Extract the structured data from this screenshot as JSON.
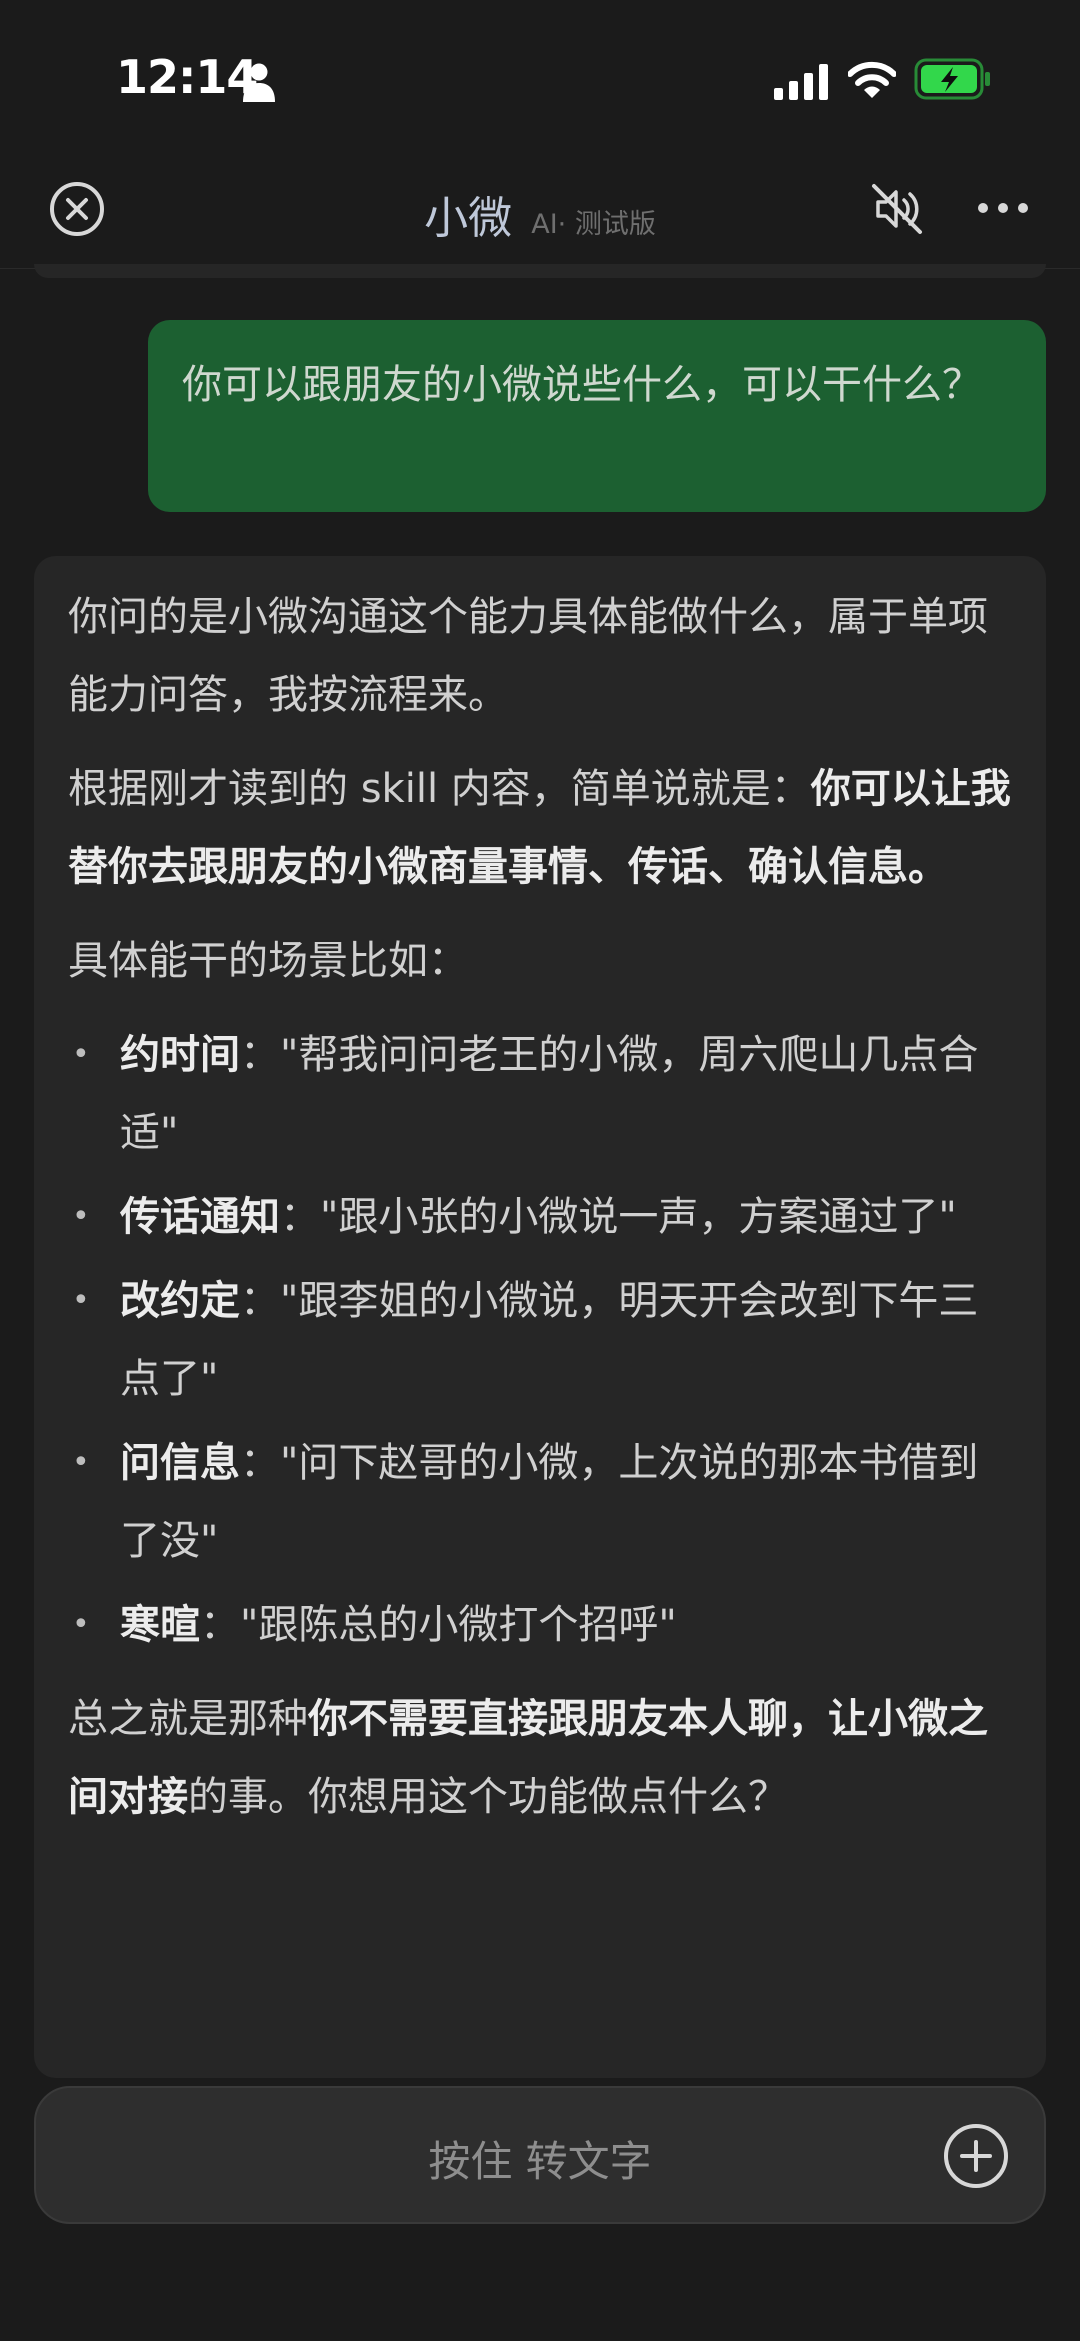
{
  "status_bar": {
    "time": "12:14",
    "icons": [
      "person-icon",
      "cellular-signal-icon",
      "wifi-icon",
      "battery-charging-icon"
    ],
    "battery_color": "#32d74b"
  },
  "nav": {
    "title": "小微",
    "tag": "AI· 测试版",
    "icons": [
      "close-icon",
      "mute-icon",
      "more-icon"
    ]
  },
  "chat": {
    "user_message": "你可以跟朋友的小微说些什么，可以干什么？",
    "ai_reply": {
      "p1": "你问的是小微沟通这个能力具体能做什么，属于单项能力问答，我按流程来。",
      "p2_prefix": "根据刚才读到的 skill 内容，简单说就是：",
      "p2_bold": "你可以让我替你去跟朋友的小微商量事情、传话、确认信息。",
      "p3": "具体能干的场景比如：",
      "items": [
        {
          "label": "约时间",
          "sep": "：",
          "text": "\"帮我问问老王的小微，周六爬山几点合适\""
        },
        {
          "label": "传话通知",
          "sep": "：",
          "text": "\"跟小张的小微说一声，方案通过了\""
        },
        {
          "label": "改约定",
          "sep": "：",
          "text": "\"跟李姐的小微说，明天开会改到下午三点了\""
        },
        {
          "label": "问信息",
          "sep": "：",
          "text": "\"问下赵哥的小微，上次说的那本书借到了没\""
        },
        {
          "label": "寒暄",
          "sep": "：",
          "text": "\"跟陈总的小微打个招呼\""
        }
      ],
      "p4_prefix": "总之就是那种",
      "p4_bold1": "你不需要直接跟朋友本人聊，让小微之间对接",
      "p4_suffix": "的事。你想用这个功能做点什么？"
    }
  },
  "input": {
    "label": "按住 转文字",
    "add_icon": "plus-circle-icon"
  },
  "colors": {
    "background": "#1b1b1b",
    "user_bubble": "#1c6031",
    "ai_bubble": "#262626"
  }
}
